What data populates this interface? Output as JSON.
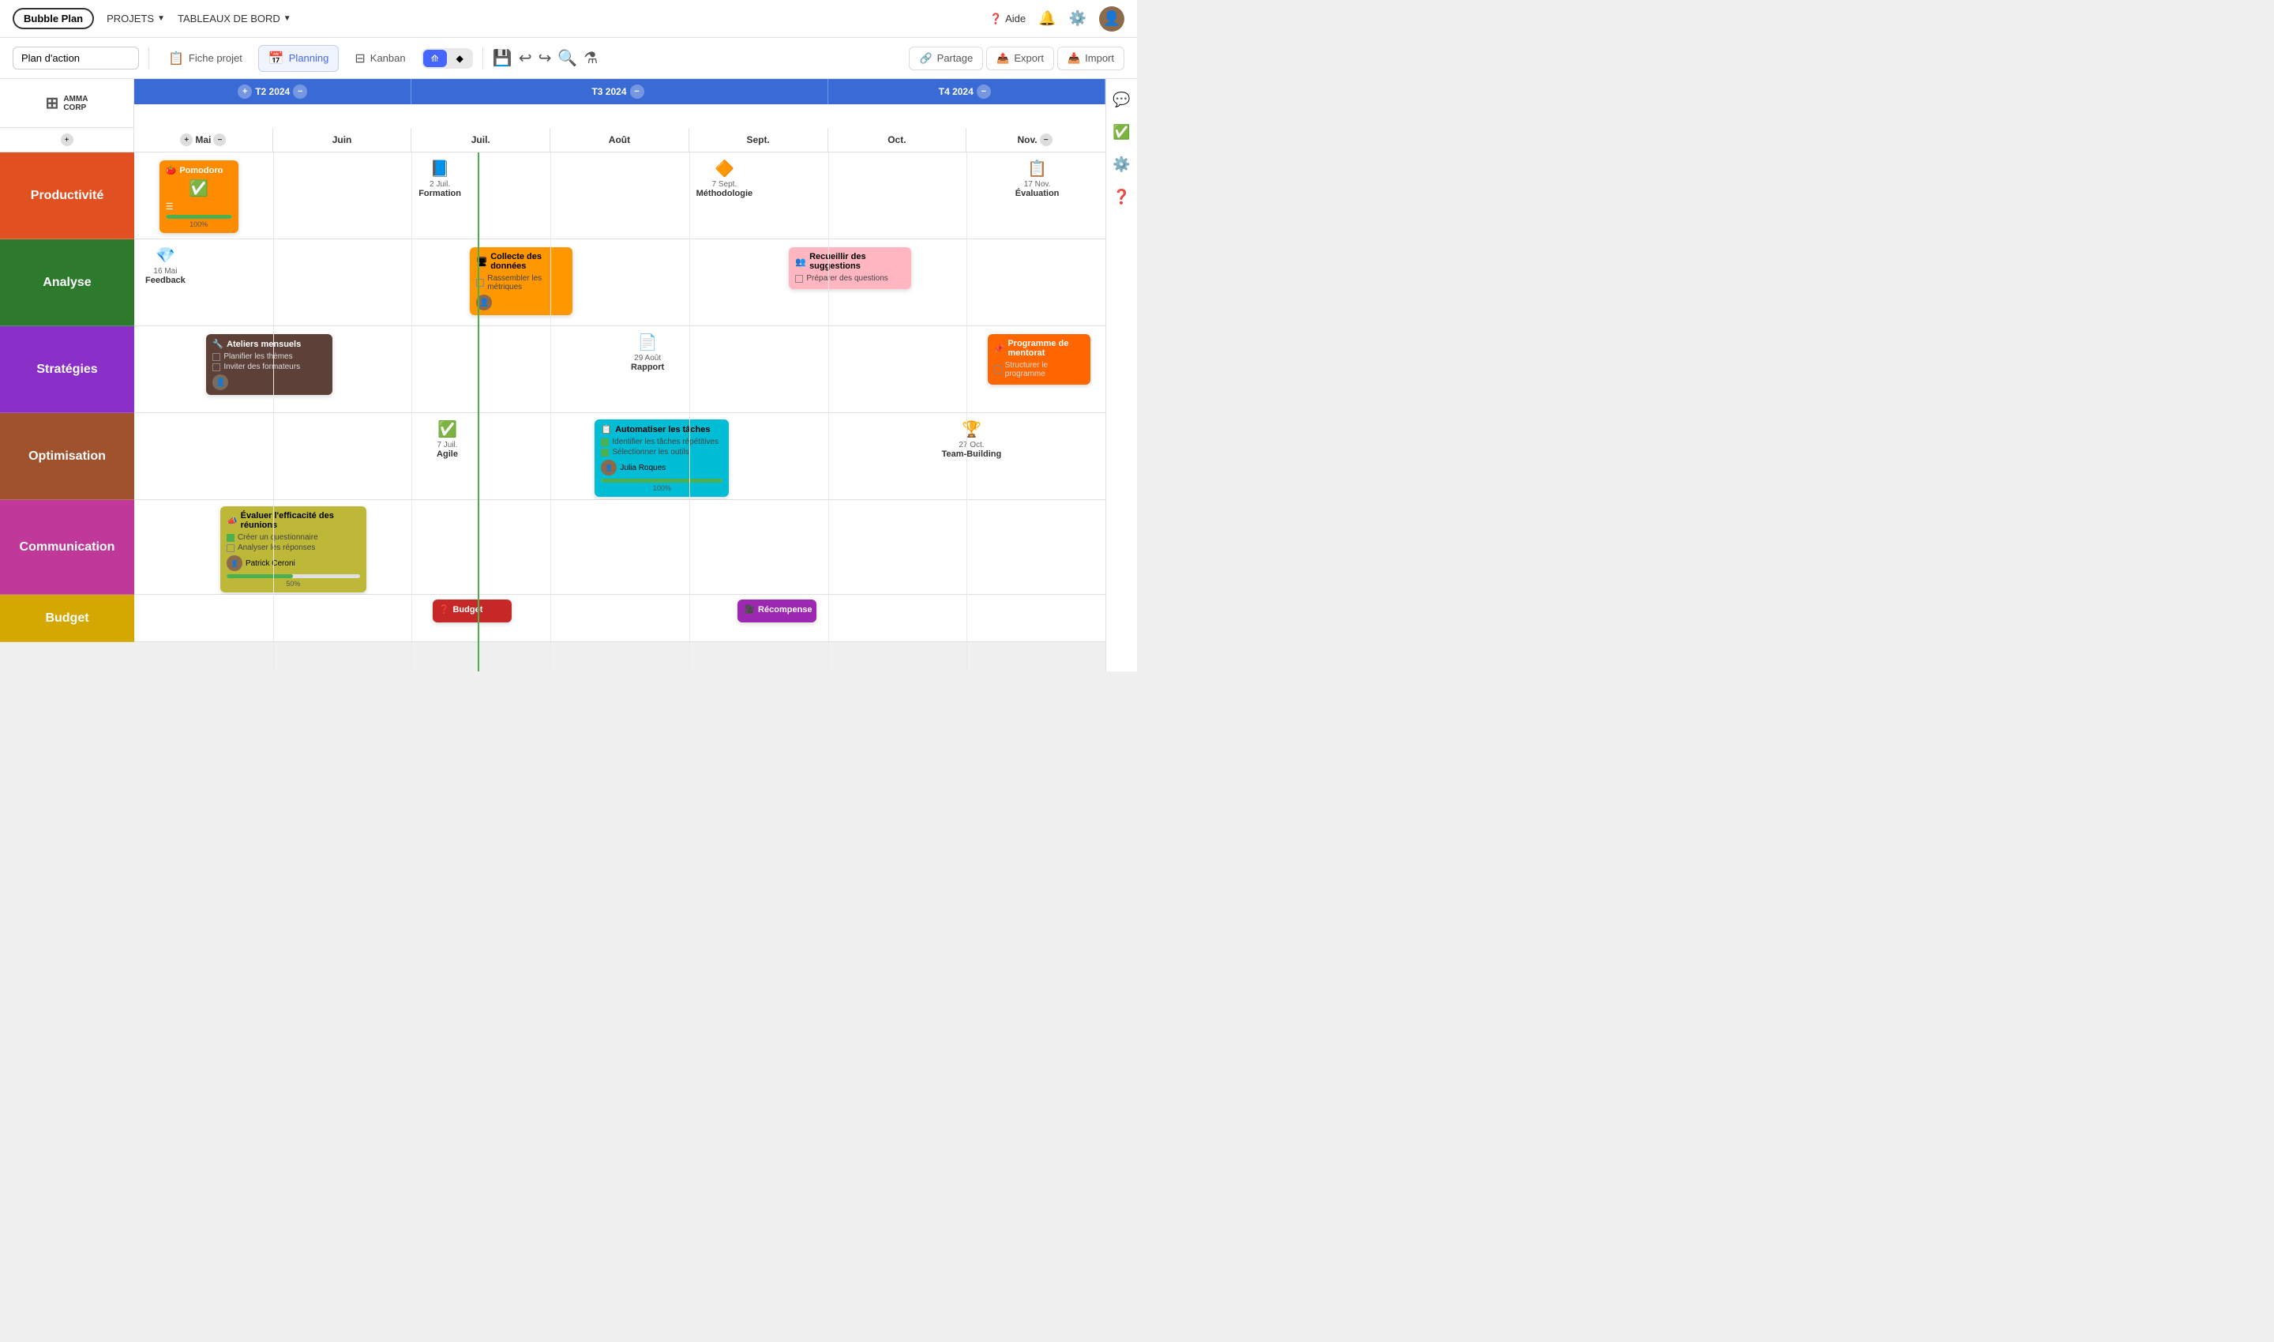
{
  "app": {
    "name": "Bubble Plan",
    "logo_label": "Bubble Plan"
  },
  "nav": {
    "projets_label": "PROJETS",
    "tableaux_label": "TABLEAUX DE BORD",
    "aide_label": "Aide"
  },
  "toolbar": {
    "project_name": "Plan d'action",
    "fiche_projet": "Fiche projet",
    "planning": "Planning",
    "kanban": "Kanban",
    "partage": "Partage",
    "export": "Export",
    "import": "Import"
  },
  "timeline": {
    "quarters": [
      {
        "id": "q2",
        "label": "T2 2024",
        "span": 2
      },
      {
        "id": "q3",
        "label": "T3 2024",
        "span": 3
      },
      {
        "id": "q4",
        "label": "T4 2024",
        "span": 2
      }
    ],
    "months": [
      "Mai",
      "Juin",
      "Juil.",
      "Août",
      "Sept.",
      "Oct.",
      "Nov."
    ]
  },
  "rows": [
    {
      "id": "productivite",
      "label": "Productivité",
      "color": "#E05020"
    },
    {
      "id": "analyse",
      "label": "Analyse",
      "color": "#2D7A2D"
    },
    {
      "id": "strategies",
      "label": "Stratégies",
      "color": "#8B2FC9"
    },
    {
      "id": "optimisation",
      "label": "Optimisation",
      "color": "#A0522D"
    },
    {
      "id": "communication",
      "label": "Communication",
      "color": "#C0399A"
    },
    {
      "id": "budget",
      "label": "Budget",
      "color": "#D4A800"
    }
  ],
  "milestones": {
    "productivite": [
      {
        "date": "",
        "label": "Pomodoro",
        "icon": "🍅",
        "type": "bubble",
        "col": 0.3,
        "style": "orange"
      },
      {
        "date": "2 Juil.",
        "label": "Formation",
        "icon": "📘",
        "type": "milestone",
        "col": 2.05
      },
      {
        "date": "7 Sept.",
        "label": "Méthodologie",
        "icon": "🔶",
        "type": "milestone",
        "col": 4.05
      },
      {
        "date": "17 Nov.",
        "label": "Évaluation",
        "icon": "📋",
        "type": "milestone",
        "col": 6.35
      }
    ],
    "analyse": [
      {
        "date": "16 Mai",
        "label": "Feedback",
        "icon": "💎",
        "type": "milestone",
        "col": 0.15
      },
      {
        "date": "",
        "label": "Collecte des données",
        "icon": "🖥",
        "type": "bubble",
        "col": 2.45,
        "style": "orange"
      },
      {
        "date": "",
        "label": "Recueillir des suggestions",
        "icon": "👥",
        "type": "bubble",
        "col": 4.75,
        "style": "pink"
      }
    ],
    "strategies": [
      {
        "date": "",
        "label": "Ateliers mensuels",
        "icon": "🔧",
        "type": "bubble",
        "col": 0.75,
        "style": "brown"
      },
      {
        "date": "29 Août",
        "label": "Rapport",
        "icon": "📄",
        "type": "milestone",
        "col": 3.6
      },
      {
        "date": "",
        "label": "Programme de mentorat",
        "icon": "📌",
        "type": "bubble",
        "col": 6.2,
        "style": "orange2"
      }
    ],
    "optimisation": [
      {
        "date": "7 Juil.",
        "label": "Agile",
        "icon": "✅",
        "type": "milestone",
        "col": 2.2
      },
      {
        "date": "",
        "label": "Automatiser les tâches",
        "icon": "📋",
        "type": "bubble",
        "col": 3.35,
        "style": "cyan"
      },
      {
        "date": "27 Oct.",
        "label": "Team-Building",
        "icon": "🏆",
        "type": "milestone",
        "col": 5.85
      }
    ],
    "communication": [
      {
        "date": "",
        "label": "Évaluer l'efficacité des réunions",
        "icon": "📣",
        "type": "bubble",
        "col": 0.85,
        "style": "olive"
      }
    ],
    "budget": [
      {
        "date": "",
        "label": "Budget",
        "icon": "❓",
        "type": "bubble",
        "col": 2.2,
        "style": "red"
      },
      {
        "date": "",
        "label": "Récompense",
        "icon": "🎥",
        "type": "bubble",
        "col": 4.4,
        "style": "purple"
      }
    ]
  },
  "right_sidebar": {
    "icons": [
      "💬",
      "✅",
      "⚙️",
      "❓"
    ]
  },
  "colors": {
    "quarter_bg": "#3a6bd4",
    "today_line": "#4CAF50",
    "accent_blue": "#4466ff"
  }
}
